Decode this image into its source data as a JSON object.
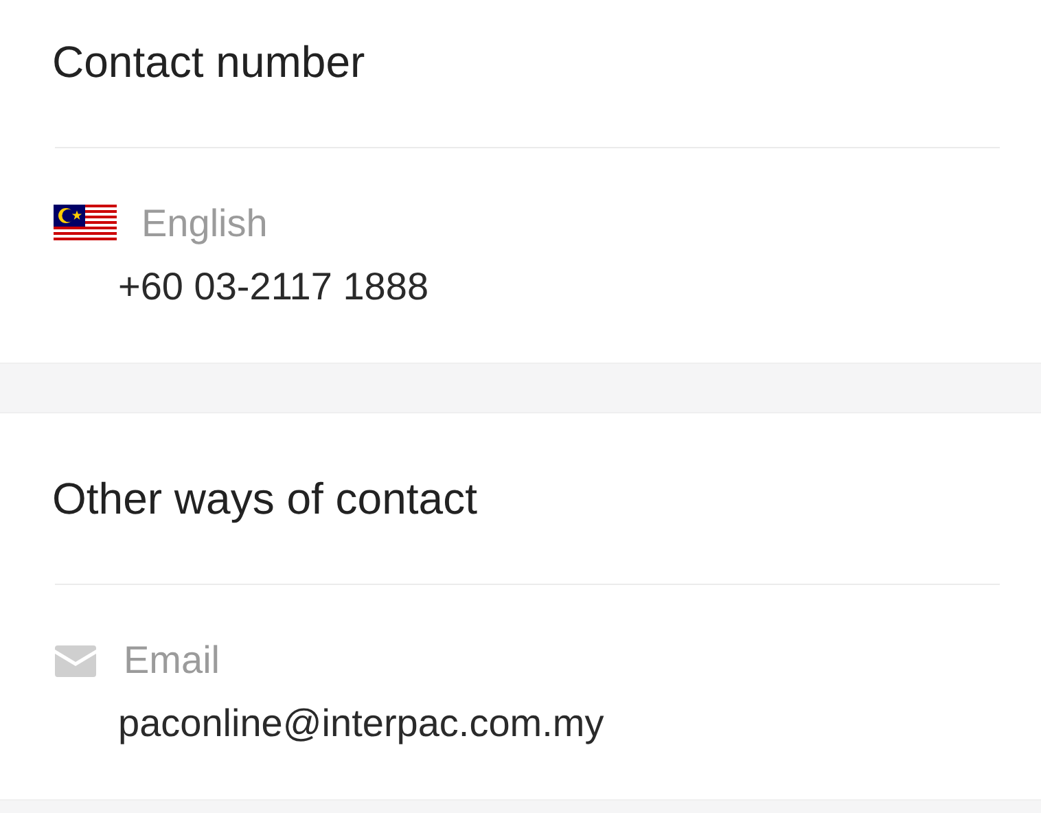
{
  "sections": [
    {
      "title": "Contact number",
      "entries": [
        {
          "kind": "flag",
          "label": "English",
          "value": "+60 03-2117 1888"
        }
      ]
    },
    {
      "title": "Other ways of contact",
      "entries": [
        {
          "kind": "email",
          "label": "Email",
          "value": "paconline@interpac.com.my"
        }
      ]
    }
  ]
}
